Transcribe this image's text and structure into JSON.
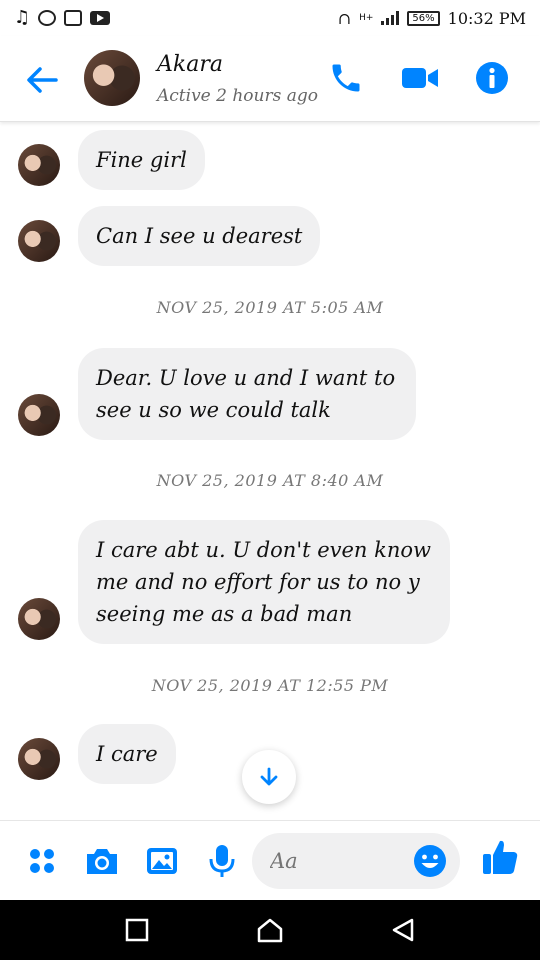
{
  "status_bar": {
    "time": "10:32 PM",
    "battery": "56%",
    "network": "H+"
  },
  "header": {
    "contact_name": "Akara",
    "contact_status": "Active 2 hours ago"
  },
  "messages": [
    {
      "type": "received",
      "text": "Fine girl"
    },
    {
      "type": "received",
      "text": "Can I see u dearest"
    },
    {
      "type": "timestamp",
      "text": "NOV 25, 2019 AT 5:05 AM"
    },
    {
      "type": "received",
      "text": "Dear. U love u and I want to see u so we could talk"
    },
    {
      "type": "timestamp",
      "text": "NOV 25, 2019 AT 8:40 AM"
    },
    {
      "type": "received",
      "text": "I care abt u. U don't even know me and no effort for us to no y seeing me as a bad man"
    },
    {
      "type": "timestamp",
      "text": "NOV 25, 2019 AT 12:55 PM"
    },
    {
      "type": "received",
      "text": "I care"
    }
  ],
  "composer": {
    "placeholder": "Aa"
  },
  "colors": {
    "accent": "#0084ff",
    "bubble": "#f0f0f1"
  }
}
